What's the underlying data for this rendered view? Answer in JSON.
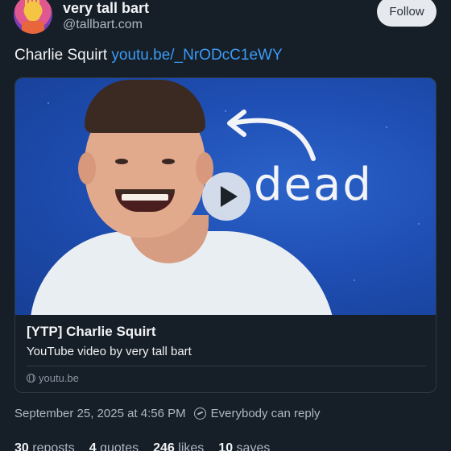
{
  "author": {
    "display_name": "very tall bart",
    "handle": "@tallbart.com",
    "avatar_icon": "bart-simpson-avatar"
  },
  "follow_label": "Follow",
  "post": {
    "text": "Charlie Squirt ",
    "link": "youtu.be/_NrODcC1eWY"
  },
  "embed": {
    "thumbnail_text": "dead",
    "title": "[YTP] Charlie Squirt",
    "description": "YouTube video by very tall bart",
    "domain": "youtu.be"
  },
  "meta": {
    "timestamp": "September 25, 2025 at 4:56 PM",
    "reply_setting": "Everybody can reply"
  },
  "stats": {
    "reposts_count": "30",
    "reposts_label": "reposts",
    "quotes_count": "4",
    "quotes_label": "quotes",
    "likes_count": "246",
    "likes_label": "likes",
    "saves_count": "10",
    "saves_label": "saves"
  },
  "colors": {
    "background": "#161e27",
    "link": "#3b9cf5",
    "muted": "#aeb7c2"
  }
}
